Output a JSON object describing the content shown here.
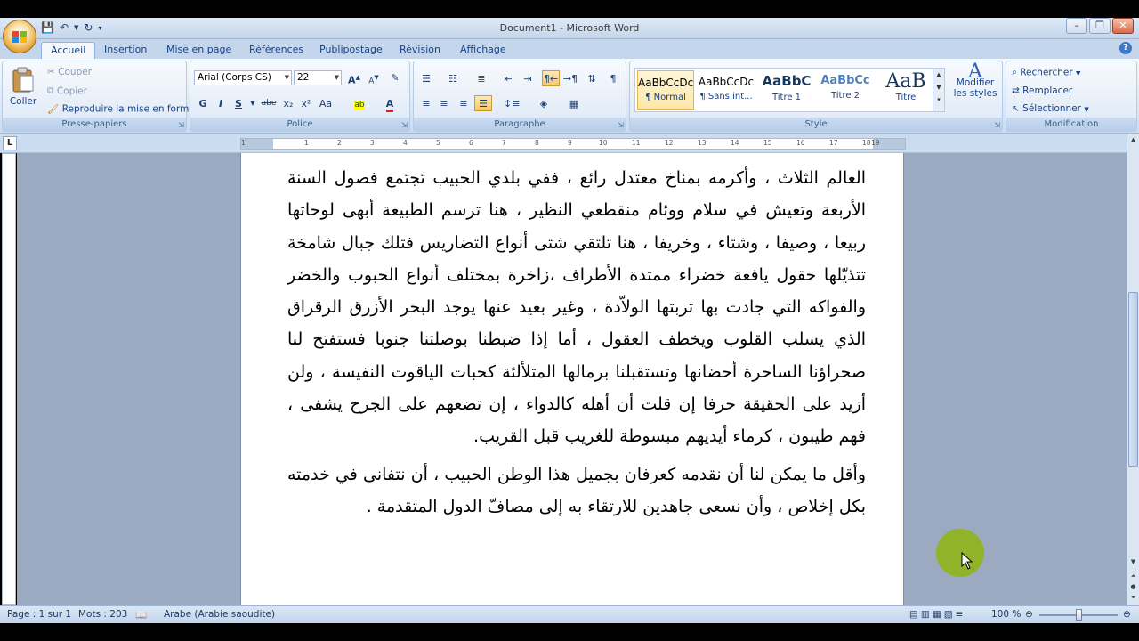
{
  "window": {
    "title": "Document1 - Microsoft Word",
    "controls": [
      "–",
      "❐",
      "✕"
    ]
  },
  "quick_access": {
    "icons": [
      "save-icon",
      "undo-icon",
      "redo-icon",
      "customize-icon"
    ]
  },
  "tabs": [
    {
      "label": "Accueil",
      "active": true
    },
    {
      "label": "Insertion"
    },
    {
      "label": "Mise en page"
    },
    {
      "label": "Références"
    },
    {
      "label": "Publipostage"
    },
    {
      "label": "Révision"
    },
    {
      "label": "Affichage"
    }
  ],
  "clipboard": {
    "paste": "Coller",
    "cut": "Couper",
    "copy": "Copier",
    "format_painter": "Reproduire la mise en forme",
    "label": "Presse-papiers"
  },
  "font": {
    "name": "Arial (Corps CS)",
    "size": "22",
    "grow": "A",
    "shrink": "A",
    "clear": "✎",
    "bold": "G",
    "italic": "I",
    "underline": "S",
    "strike": "abe",
    "subscript": "x₂",
    "superscript": "x²",
    "case": "Aa",
    "highlight": "ab",
    "color": "A",
    "label": "Police"
  },
  "paragraph": {
    "label": "Paragraphe",
    "pilcrow": "¶"
  },
  "styles": {
    "items": [
      {
        "preview": "AaBbCcDc",
        "name": "¶ Normal",
        "selected": true
      },
      {
        "preview": "AaBbCcDc",
        "name": "¶ Sans int..."
      },
      {
        "preview": "AaBbC",
        "name": "Titre 1"
      },
      {
        "preview": "AaBbCc",
        "name": "Titre 2"
      },
      {
        "preview": "AaB",
        "name": "Titre"
      }
    ],
    "change": "Modifier les styles",
    "label": "Style"
  },
  "editing": {
    "find": "Rechercher",
    "replace": "Remplacer",
    "select": "Sélectionner",
    "label": "Modification"
  },
  "ruler": {
    "tab_selector": "L",
    "numbers": [
      "1",
      "1",
      "2",
      "3",
      "4",
      "5",
      "6",
      "7",
      "8",
      "9",
      "10",
      "11",
      "12",
      "13",
      "14",
      "15",
      "16",
      "17",
      "18",
      "19"
    ]
  },
  "document": {
    "paragraphs": [
      "العالم الثلاث ، وأكرمه بمناخ معتدل رائع ، ففي بلدي الحبيب تجتمع فصول السنة الأربعة وتعيش في سلام ووئام منقطعي النظير ، هنا ترسم الطبيعة أبهى لوحاتها ربيعا ، وصيفا ، وشتاء ، وخريفا ، هنا تلتقي شتى أنواع التضاريس فتلك جبال شامخة تتذيّلها حقول يافعة خضراء ممتدة الأطراف ،زاخرة بمختلف أنواع الحبوب والخضر والفواكه التي جادت بها تربتها الولاّدة ، وغير بعيد عنها يوجد البحر الأزرق الرقراق الذي يسلب القلوب ويخطف العقول ، أما إذا ضبطنا بوصلتنا جنوبا فستفتح لنا صحراؤنا الساحرة أحضانها وتستقبلنا برمالها المتلألئة كحبات الياقوت النفيسة ، ولن أزيد على الحقيقة حرفا إن قلت أن أهله كالدواء ، إن تضعهم على الجرح يشفى ، فهم طيبون ، كرماء أيديهم مبسوطة للغريب قبل القريب.",
      "وأقل ما يمكن لنا أن نقدمه كعرفان بجميل هذا الوطن الحبيب ، أن نتفانى في خدمته بكل إخلاص ، وأن نسعى جاهدين للارتقاء به إلى مصافّ الدول المتقدمة ."
    ]
  },
  "status": {
    "page": "Page : 1 sur 1",
    "words": "Mots : 203",
    "language": "Arabe (Arabie saoudite)",
    "zoom": "100 %"
  },
  "colors": {
    "accent": "#15428b",
    "highlight_ring": "#8fb41c",
    "font_color": "#e02020",
    "highlight_color": "#ffff00"
  }
}
